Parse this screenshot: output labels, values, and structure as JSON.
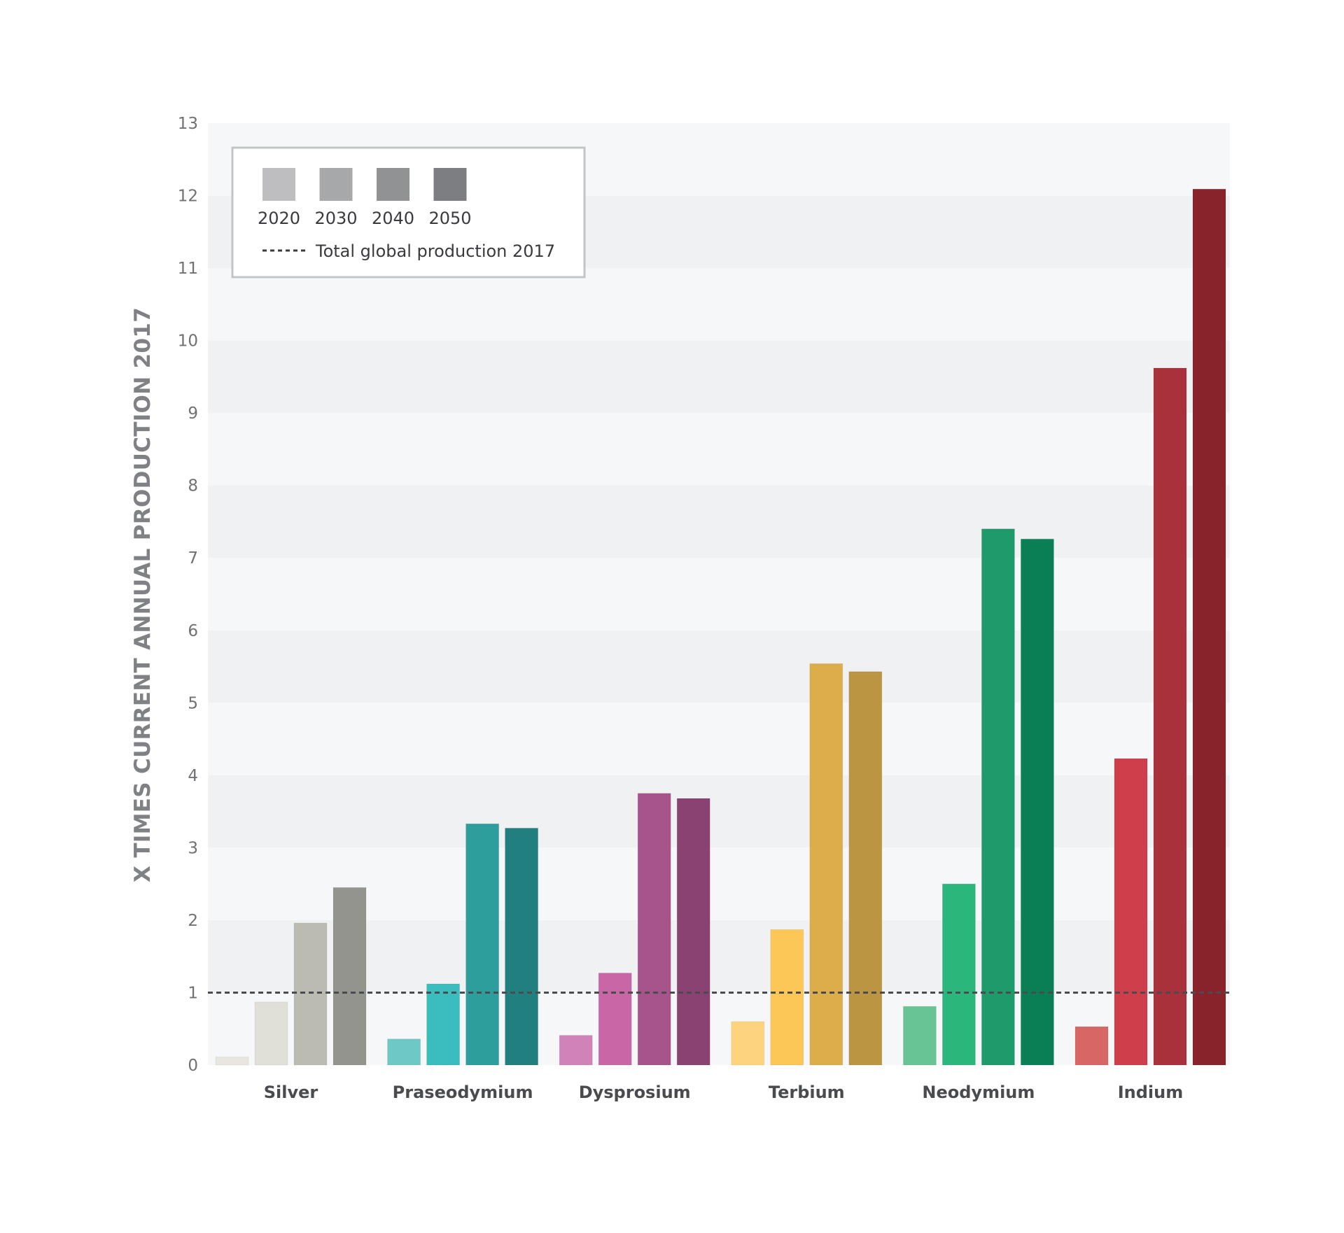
{
  "chart_data": {
    "type": "bar",
    "title": "",
    "xlabel": "",
    "ylabel": "X TIMES CURRENT ANNUAL PRODUCTION 2017",
    "ylim": [
      0,
      13
    ],
    "yticks": [
      0,
      1,
      2,
      3,
      4,
      5,
      6,
      7,
      8,
      9,
      10,
      11,
      12,
      13
    ],
    "grid": "alternating horizontal bands",
    "legend_position": "top-left",
    "categories": [
      "Silver",
      "Praseodymium",
      "Dysprosium",
      "Terbium",
      "Neodymium",
      "Indium"
    ],
    "series": [
      {
        "name": "2020",
        "values": [
          0.11,
          0.36,
          0.41,
          0.6,
          0.81,
          0.53
        ]
      },
      {
        "name": "2030",
        "values": [
          0.87,
          1.12,
          1.27,
          1.87,
          2.5,
          4.23
        ]
      },
      {
        "name": "2040",
        "values": [
          1.96,
          3.33,
          3.75,
          5.54,
          7.4,
          9.62
        ]
      },
      {
        "name": "2050",
        "values": [
          2.45,
          3.27,
          3.68,
          5.43,
          7.26,
          12.09
        ]
      }
    ],
    "reference_line": {
      "label": "Total global production 2017",
      "value": 1,
      "style": "dotted"
    },
    "legend": {
      "items": [
        {
          "label": "2020",
          "color": "#bebec0"
        },
        {
          "label": "2030",
          "color": "#a7a8aa"
        },
        {
          "label": "2040",
          "color": "#919294"
        },
        {
          "label": "2050",
          "color": "#7d7e81"
        }
      ],
      "line_label": "Total global production 2017"
    },
    "category_colors": {
      "Silver": [
        "#e8e6df",
        "#e0dfd8",
        "#bbbbb2",
        "#93948e"
      ],
      "Praseodymium": [
        "#6ec8c6",
        "#3bbdbd",
        "#2e9e9d",
        "#217f7f"
      ],
      "Dysprosium": [
        "#d183b8",
        "#c866a6",
        "#a7548a",
        "#8a4272"
      ],
      "Terbium": [
        "#fdd47d",
        "#fcc757",
        "#dcae4b",
        "#bc9542"
      ],
      "Neodymium": [
        "#69c495",
        "#2bb77c",
        "#1f9a6b",
        "#0a7f56"
      ],
      "Indium": [
        "#d86664",
        "#cf3e4b",
        "#a9313c",
        "#88222b"
      ]
    },
    "band_colors": {
      "light": "#f6f7f9",
      "dark": "#f0f1f3"
    },
    "reference_line_color": "#4a4b4e"
  }
}
